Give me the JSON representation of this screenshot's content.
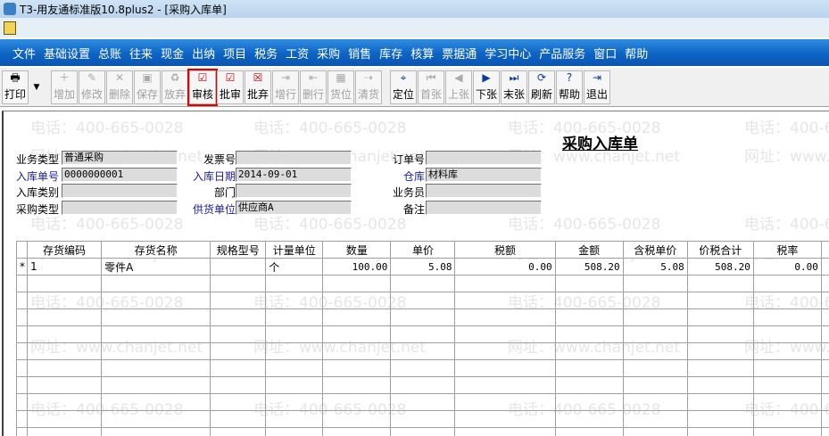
{
  "window": {
    "title": "T3-用友通标准版10.8plus2 - [采购入库单]"
  },
  "menu": [
    "文件",
    "基础设置",
    "总账",
    "往来",
    "现金",
    "出纳",
    "项目",
    "税务",
    "工资",
    "采购",
    "销售",
    "库存",
    "核算",
    "票据通",
    "学习中心",
    "产品服务",
    "窗口",
    "帮助"
  ],
  "toolbar": {
    "print": "打印",
    "group1": [
      {
        "label": "增加",
        "icon": "＋",
        "en": false
      },
      {
        "label": "修改",
        "icon": "✎",
        "en": false
      },
      {
        "label": "删除",
        "icon": "✕",
        "en": false
      },
      {
        "label": "保存",
        "icon": "▣",
        "en": false
      },
      {
        "label": "放弃",
        "icon": "♻",
        "en": false
      },
      {
        "label": "审核",
        "icon": "☑",
        "en": true,
        "sel": true
      },
      {
        "label": "批审",
        "icon": "☑",
        "en": true
      },
      {
        "label": "批弃",
        "icon": "☒",
        "en": true
      },
      {
        "label": "增行",
        "icon": "⇥",
        "en": false
      },
      {
        "label": "删行",
        "icon": "⇤",
        "en": false
      },
      {
        "label": "货位",
        "icon": "▦",
        "en": false
      },
      {
        "label": "清货",
        "icon": "⇢",
        "en": false
      }
    ],
    "group2": [
      {
        "label": "定位",
        "icon": "⌖",
        "en": true
      },
      {
        "label": "首张",
        "icon": "⏮",
        "en": false
      },
      {
        "label": "上张",
        "icon": "◀",
        "en": false
      },
      {
        "label": "下张",
        "icon": "▶",
        "en": true
      },
      {
        "label": "末张",
        "icon": "⏭",
        "en": true
      },
      {
        "label": "刷新",
        "icon": "⟳",
        "en": true
      },
      {
        "label": "帮助",
        "icon": "?",
        "en": true
      },
      {
        "label": "退出",
        "icon": "⇥",
        "en": true
      }
    ]
  },
  "watermark": {
    "phone": "电话：400-665-0028",
    "web": "网址：www.chanjet.net"
  },
  "form": {
    "title": "采购入库单",
    "biz_type": {
      "label": "业务类型",
      "value": "普通采购"
    },
    "invoice_no": {
      "label": "发票号",
      "value": ""
    },
    "order_no": {
      "label": "订单号",
      "value": ""
    },
    "receipt_no": {
      "label": "入库单号",
      "value": "0000000001"
    },
    "receipt_date": {
      "label": "入库日期",
      "value": "2014-09-01"
    },
    "warehouse": {
      "label": "仓库",
      "value": "材料库"
    },
    "receipt_type": {
      "label": "入库类别",
      "value": ""
    },
    "dept": {
      "label": "部门",
      "value": ""
    },
    "clerk": {
      "label": "业务员",
      "value": ""
    },
    "purchase_type": {
      "label": "采购类型",
      "value": ""
    },
    "supplier": {
      "label": "供货单位",
      "value": "供应商A"
    },
    "remark": {
      "label": "备注",
      "value": ""
    }
  },
  "grid": {
    "columns": [
      "存货编码",
      "存货名称",
      "规格型号",
      "计量单位",
      "数量",
      "单价",
      "税额",
      "金额",
      "含税单价",
      "价税合计",
      "税率"
    ],
    "rows": [
      {
        "marker": "*",
        "cells": [
          "1",
          "零件A",
          "",
          "个",
          "100.00",
          "5.08",
          "0.00",
          "508.20",
          "5.08",
          "508.20",
          "0.00"
        ]
      }
    ]
  }
}
